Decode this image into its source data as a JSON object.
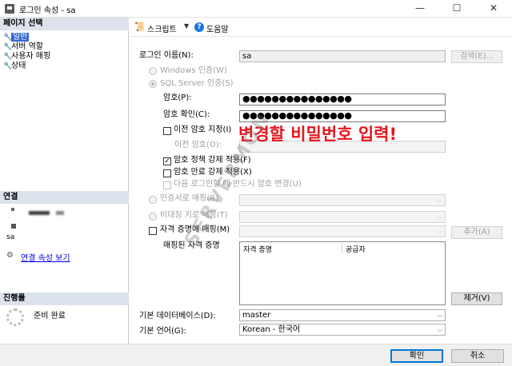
{
  "window": {
    "title": "로그인 속성 - sa",
    "minimize": "—",
    "maximize": "☐",
    "close": "✕"
  },
  "left": {
    "page_select_header": "페이지 선택",
    "pages": [
      "일반",
      "서버 역할",
      "사용자 매핑",
      "상태"
    ],
    "connection_header": "연결",
    "connection_user": "sa",
    "connection_link": "연결 속성 보기",
    "progress_header": "진행률",
    "progress_status": "준비 완료"
  },
  "toolbar": {
    "script_label": "스크립트",
    "help_label": "도움말"
  },
  "form": {
    "login_name_label": "로그인 이름(N):",
    "login_name_value": "sa",
    "search_button": "검색(E)...",
    "windows_auth": "Windows 인증(W)",
    "sql_auth": "SQL Server 인증(S)",
    "password_label": "암호(P):",
    "password_value": "●●●●●●●●●●●●●●●",
    "confirm_label": "암호 확인(C):",
    "confirm_value": "●●●●●●●●●●●●●●●",
    "specify_old": "이전 암호 지정(I)",
    "old_password_label": "이전 암호(O):",
    "enforce_policy": "암호 정책 강제 적용(F)",
    "enforce_expiration": "암호 만료 강제 적용(X)",
    "must_change": "다음 로그인할 때 반드시 암호 변경(U)",
    "cert_mapped": "인증서로 매핑(R)",
    "asym_key_mapped": "비대칭 키로 매핑(T)",
    "credential_mapped": "자격 증명에 매핑(M)",
    "add_button": "추가(A)",
    "mapped_credentials_label": "매핑된 자격 증명",
    "cred_columns": [
      "자격 증명",
      "공급자"
    ],
    "remove_button": "제거(V)",
    "default_db_label": "기본 데이터베이스(D):",
    "default_db_value": "master",
    "default_lang_label": "기본 언어(G):",
    "default_lang_value": "Korean - 한국어"
  },
  "annotation": {
    "text": "변경할 비밀번호 입력!",
    "color": "#e8141c"
  },
  "watermark": {
    "text": "SERVERMON"
  },
  "footer": {
    "ok_button": "확인",
    "cancel_button": "취소"
  }
}
